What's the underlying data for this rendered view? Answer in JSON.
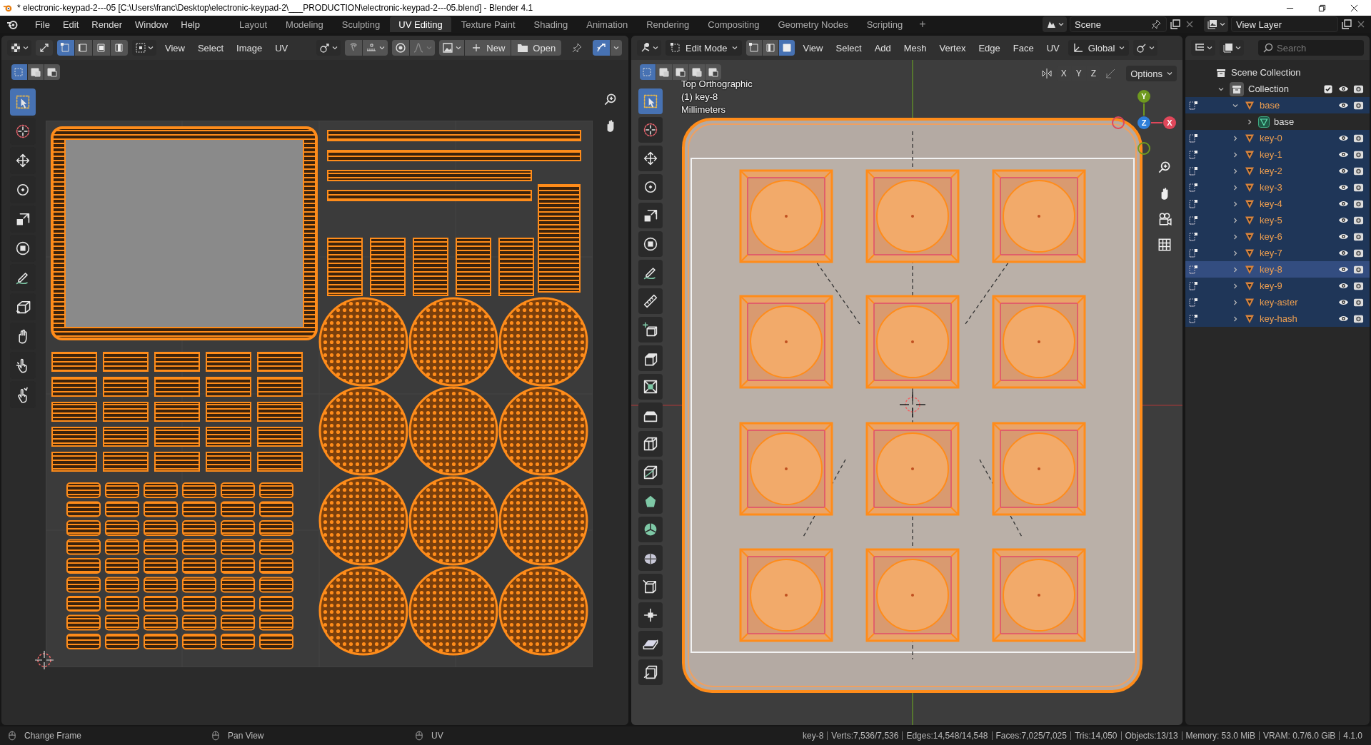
{
  "title_bar": {
    "title": "* electronic-keypad-2---05 [C:\\Users\\franc\\Desktop\\electronic-keypad-2\\___PRODUCTION\\electronic-keypad-2---05.blend] - Blender 4.1"
  },
  "menu": [
    "File",
    "Edit",
    "Render",
    "Window",
    "Help"
  ],
  "workspaces": [
    {
      "label": "Layout",
      "selected": false
    },
    {
      "label": "Modeling",
      "selected": false
    },
    {
      "label": "Sculpting",
      "selected": false
    },
    {
      "label": "UV Editing",
      "selected": true
    },
    {
      "label": "Texture Paint",
      "selected": false
    },
    {
      "label": "Shading",
      "selected": false
    },
    {
      "label": "Animation",
      "selected": false
    },
    {
      "label": "Rendering",
      "selected": false
    },
    {
      "label": "Compositing",
      "selected": false
    },
    {
      "label": "Geometry Nodes",
      "selected": false
    },
    {
      "label": "Scripting",
      "selected": false
    }
  ],
  "add_workspace": "+",
  "scene": {
    "name": "Scene"
  },
  "view_layer": {
    "name": "View Layer"
  },
  "uv_editor": {
    "select_modes": [
      {
        "selected": true
      },
      {
        "selected": false
      },
      {
        "selected": false
      },
      {
        "selected": false
      }
    ],
    "menus": [
      "View",
      "Select",
      "Image",
      "UV"
    ],
    "new_label": "New",
    "open_label": "Open",
    "box_modes": [
      {
        "selected": true
      },
      {
        "selected": false
      },
      {
        "selected": false
      }
    ],
    "tools": [
      {
        "kind": "select",
        "selected": true
      },
      {
        "kind": "cursor",
        "selected": false
      },
      {
        "kind": "move",
        "selected": false
      },
      {
        "kind": "rotate",
        "selected": false
      },
      {
        "kind": "scale",
        "selected": false
      },
      {
        "kind": "transform",
        "selected": false
      },
      {
        "kind": "annotate",
        "selected": false
      },
      {
        "kind": "rip",
        "selected": false
      },
      {
        "kind": "grab",
        "selected": false
      },
      {
        "kind": "relax",
        "selected": false
      },
      {
        "kind": "pinch",
        "selected": false
      }
    ]
  },
  "viewport": {
    "mode": "Edit Mode",
    "select_modes": [
      {
        "selected": false
      },
      {
        "selected": false
      },
      {
        "selected": true
      }
    ],
    "menus": [
      "View",
      "Select",
      "Add",
      "Mesh",
      "Vertex",
      "Edge",
      "Face",
      "UV"
    ],
    "orientation": "Global",
    "box_modes": [
      {
        "selected": true
      },
      {
        "selected": false
      },
      {
        "selected": false
      },
      {
        "selected": false
      },
      {
        "selected": false
      }
    ],
    "axes": [
      "X",
      "Y",
      "Z"
    ],
    "options": "Options",
    "overlay_lines": [
      "Top Orthographic",
      "(1) key-8",
      "Millimeters"
    ],
    "gizmo": [
      {
        "label": "Y",
        "color": "#6f9a1f"
      },
      {
        "label": "Z",
        "color": "#2f7fd8"
      },
      {
        "label": "X",
        "color": "#e0475a"
      }
    ],
    "tools": [
      {
        "kind": "select",
        "selected": true
      },
      {
        "kind": "cursor",
        "selected": false
      },
      {
        "kind": "move",
        "selected": false
      },
      {
        "kind": "rotate",
        "selected": false
      },
      {
        "kind": "scale",
        "selected": false
      },
      {
        "kind": "transform",
        "selected": false
      },
      {
        "kind": "annotate",
        "selected": false
      },
      {
        "kind": "measure",
        "selected": false
      },
      {
        "kind": "add-cube",
        "selected": false
      },
      {
        "kind": "extrude",
        "selected": false
      },
      {
        "kind": "inset",
        "selected": false
      },
      {
        "kind": "bevel",
        "selected": false
      },
      {
        "kind": "loopcut",
        "selected": false
      },
      {
        "kind": "knife",
        "selected": false
      },
      {
        "kind": "polybuild",
        "selected": false
      },
      {
        "kind": "spin",
        "selected": false
      },
      {
        "kind": "smooth",
        "selected": false
      },
      {
        "kind": "edgeslide",
        "selected": false
      },
      {
        "kind": "shrink",
        "selected": false
      },
      {
        "kind": "shear",
        "selected": false
      },
      {
        "kind": "rip3d",
        "selected": false
      }
    ]
  },
  "outliner": {
    "search_placeholder": "Search",
    "tree": [
      {
        "label": "Scene Collection",
        "kind": "scene-collection",
        "children": [
          {
            "label": "Collection",
            "kind": "collection",
            "checked": true,
            "expanded": true,
            "children": [
              {
                "label": "base",
                "kind": "object",
                "selected": true,
                "active": false,
                "expanded": true,
                "children": [
                  {
                    "label": "base",
                    "kind": "mesh-data",
                    "selected": false,
                    "active": false,
                    "expanded": false
                  }
                ]
              },
              {
                "label": "key-0",
                "kind": "object",
                "selected": true,
                "active": false,
                "expanded": false
              },
              {
                "label": "key-1",
                "kind": "object",
                "selected": true,
                "active": false,
                "expanded": false
              },
              {
                "label": "key-2",
                "kind": "object",
                "selected": true,
                "active": false,
                "expanded": false
              },
              {
                "label": "key-3",
                "kind": "object",
                "selected": true,
                "active": false,
                "expanded": false
              },
              {
                "label": "key-4",
                "kind": "object",
                "selected": true,
                "active": false,
                "expanded": false
              },
              {
                "label": "key-5",
                "kind": "object",
                "selected": true,
                "active": false,
                "expanded": false
              },
              {
                "label": "key-6",
                "kind": "object",
                "selected": true,
                "active": false,
                "expanded": false
              },
              {
                "label": "key-7",
                "kind": "object",
                "selected": true,
                "active": false,
                "expanded": false
              },
              {
                "label": "key-8",
                "kind": "object",
                "selected": true,
                "active": true,
                "expanded": false
              },
              {
                "label": "key-9",
                "kind": "object",
                "selected": true,
                "active": false,
                "expanded": false
              },
              {
                "label": "key-aster",
                "kind": "object",
                "selected": true,
                "active": false,
                "expanded": false
              },
              {
                "label": "key-hash",
                "kind": "object",
                "selected": true,
                "active": false,
                "expanded": false
              }
            ]
          }
        ]
      }
    ]
  },
  "status_bar": {
    "hints": [
      "Change Frame",
      "Pan View",
      "UV"
    ],
    "stats": [
      "key-8",
      "Verts:7,536/7,536",
      "Edges:14,548/14,548",
      "Faces:7,025/7,025",
      "Tris:14,050",
      "Objects:13/13",
      "Memory: 53.0 MiB",
      "VRAM: 0.7/6.0 GiB",
      "4.1.0"
    ]
  }
}
